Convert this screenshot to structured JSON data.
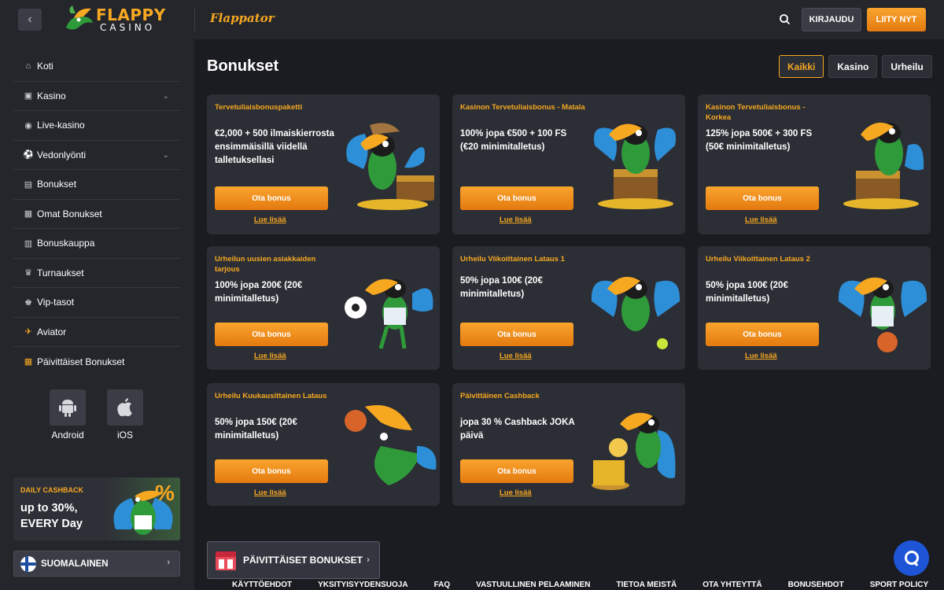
{
  "header": {
    "logo_top": "FLAPPY",
    "logo_bottom": "CASINO",
    "brand_script": "Flappator",
    "login_label": "KIRJAUDU",
    "join_label": "LIITY NYT"
  },
  "sidebar": {
    "items": [
      {
        "label": "Koti",
        "icon": "home-icon"
      },
      {
        "label": "Kasino",
        "icon": "gamepad-icon",
        "expandable": true
      },
      {
        "label": "Live-kasino",
        "icon": "live-icon"
      },
      {
        "label": "Vedonlyönti",
        "icon": "ball-icon",
        "expandable": true
      },
      {
        "label": "Bonukset",
        "icon": "gift-icon"
      },
      {
        "label": "Omat Bonukset",
        "icon": "bonus-icon"
      },
      {
        "label": "Bonuskauppa",
        "icon": "shop-icon"
      },
      {
        "label": "Turnaukset",
        "icon": "trophy-icon"
      },
      {
        "label": "Vip-tasot",
        "icon": "crown-icon"
      },
      {
        "label": "Aviator",
        "icon": "plane-icon",
        "accent": true
      },
      {
        "label": "Päivittäiset Bonukset",
        "icon": "calendar-icon",
        "accent": true
      }
    ],
    "apps": [
      {
        "label": "Android",
        "icon": "android-icon"
      },
      {
        "label": "iOS",
        "icon": "apple-icon"
      }
    ],
    "promo": {
      "small": "DAILY CASHBACK",
      "line1": "up to 30%,",
      "line2": "EVERY Day",
      "badge": "%"
    },
    "language": "SUOMALAINEN"
  },
  "main": {
    "title": "Bonukset",
    "filters": [
      {
        "label": "Kaikki",
        "active": true
      },
      {
        "label": "Kasino",
        "active": false
      },
      {
        "label": "Urheilu",
        "active": false
      }
    ],
    "cards": [
      {
        "title": "Tervetuliaisbonuspaketti",
        "body": "€2,000 + 500 ilmaiskierrosta ensimmäisillä viidellä talletuksellasi",
        "button": "Ota bonus",
        "link": "Lue lisää"
      },
      {
        "title": "Kasinon Tervetuliaisbonus - Matala",
        "body": "100% jopa €500 + 100 FS (€20 minimitalletus)",
        "button": "Ota bonus",
        "link": "Lue lisää"
      },
      {
        "title": "Kasinon Tervetuliaisbonus - Korkea",
        "body": "125% jopa 500€ + 300 FS (50€ minimitalletus)",
        "button": "Ota bonus",
        "link": "Lue lisää"
      },
      {
        "title": "Urheilun uusien asiakkaiden tarjous",
        "body": "100% jopa 200€ (20€ minimitalletus)",
        "button": "Ota bonus",
        "link": "Lue lisää"
      },
      {
        "title": "Urheilu Viikoittainen Lataus 1",
        "body": "50% jopa 100€ (20€ minimitalletus)",
        "button": "Ota bonus",
        "link": "Lue lisää"
      },
      {
        "title": "Urheilu Viikoittainen Lataus 2",
        "body": "50% jopa 100€ (20€ minimitalletus)",
        "button": "Ota bonus",
        "link": "Lue lisää"
      },
      {
        "title": "Urheilu Kuukausittainen Lataus",
        "body": "50% jopa 150€ (20€ minimitalletus)",
        "button": "Ota bonus",
        "link": "Lue lisää"
      },
      {
        "title": "Päivittäinen Cashback",
        "body": "jopa 30 % Cashback JOKA päivä",
        "button": "Ota bonus",
        "link": "Lue lisää"
      }
    ],
    "banner": "PÄIVITTÄISET BONUKSET"
  },
  "footer": {
    "links": [
      "KÄYTTÖEHDOT",
      "YKSITYISYYDENSUOJA",
      "FAQ",
      "VASTUULLINEN PELAAMINEN",
      "TIETOA MEISTÄ",
      "OTA YHTEYTTÄ",
      "BONUSEHDOT",
      "SPORT POLICY"
    ]
  },
  "colors": {
    "accent": "#f6a821",
    "bg": "#1a1c21",
    "panel": "#24262c",
    "card": "#2c2e35",
    "chat": "#1e55d6"
  }
}
